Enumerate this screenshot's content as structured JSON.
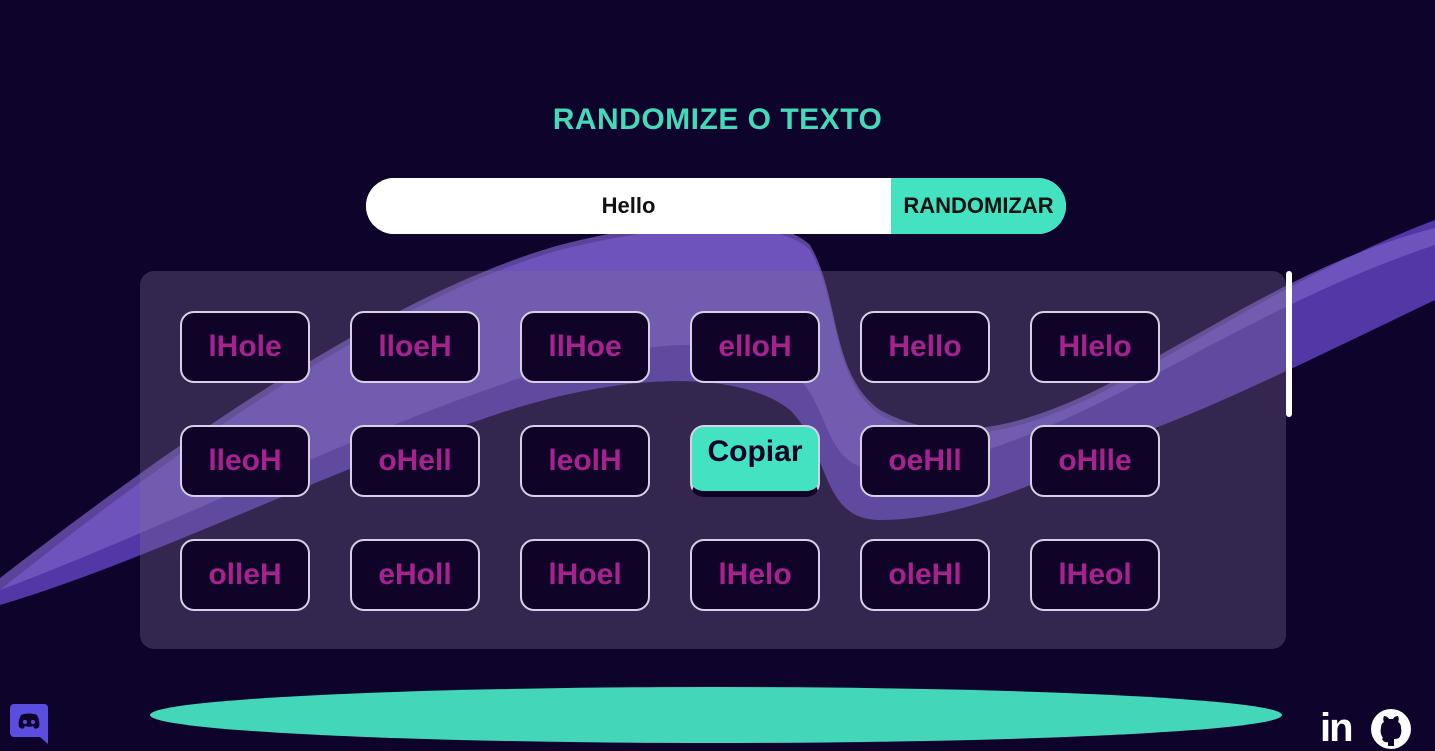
{
  "header": {
    "title": "RANDOMIZE O TEXTO"
  },
  "search": {
    "value": "Hello",
    "button_label": "RANDOMIZAR"
  },
  "results": {
    "words": [
      "lHole",
      "lloeH",
      "llHoe",
      "elloH",
      "Hello",
      "Hlelo",
      "lleoH",
      "oHell",
      "leolH",
      "Copiar",
      "oeHll",
      "oHlle",
      "olleH",
      "eHoll",
      "lHoel",
      "lHelo",
      "oleHl",
      "lHeol"
    ],
    "copy_label": "Copiar"
  },
  "footer": {
    "linkedin_label": "in",
    "icons": [
      "discord-icon",
      "linkedin-icon",
      "github-icon"
    ]
  },
  "colors": {
    "background": "#0e032a",
    "accent": "#43e3c1",
    "word_text": "#a7228f",
    "wave": "#5b3fb0"
  }
}
